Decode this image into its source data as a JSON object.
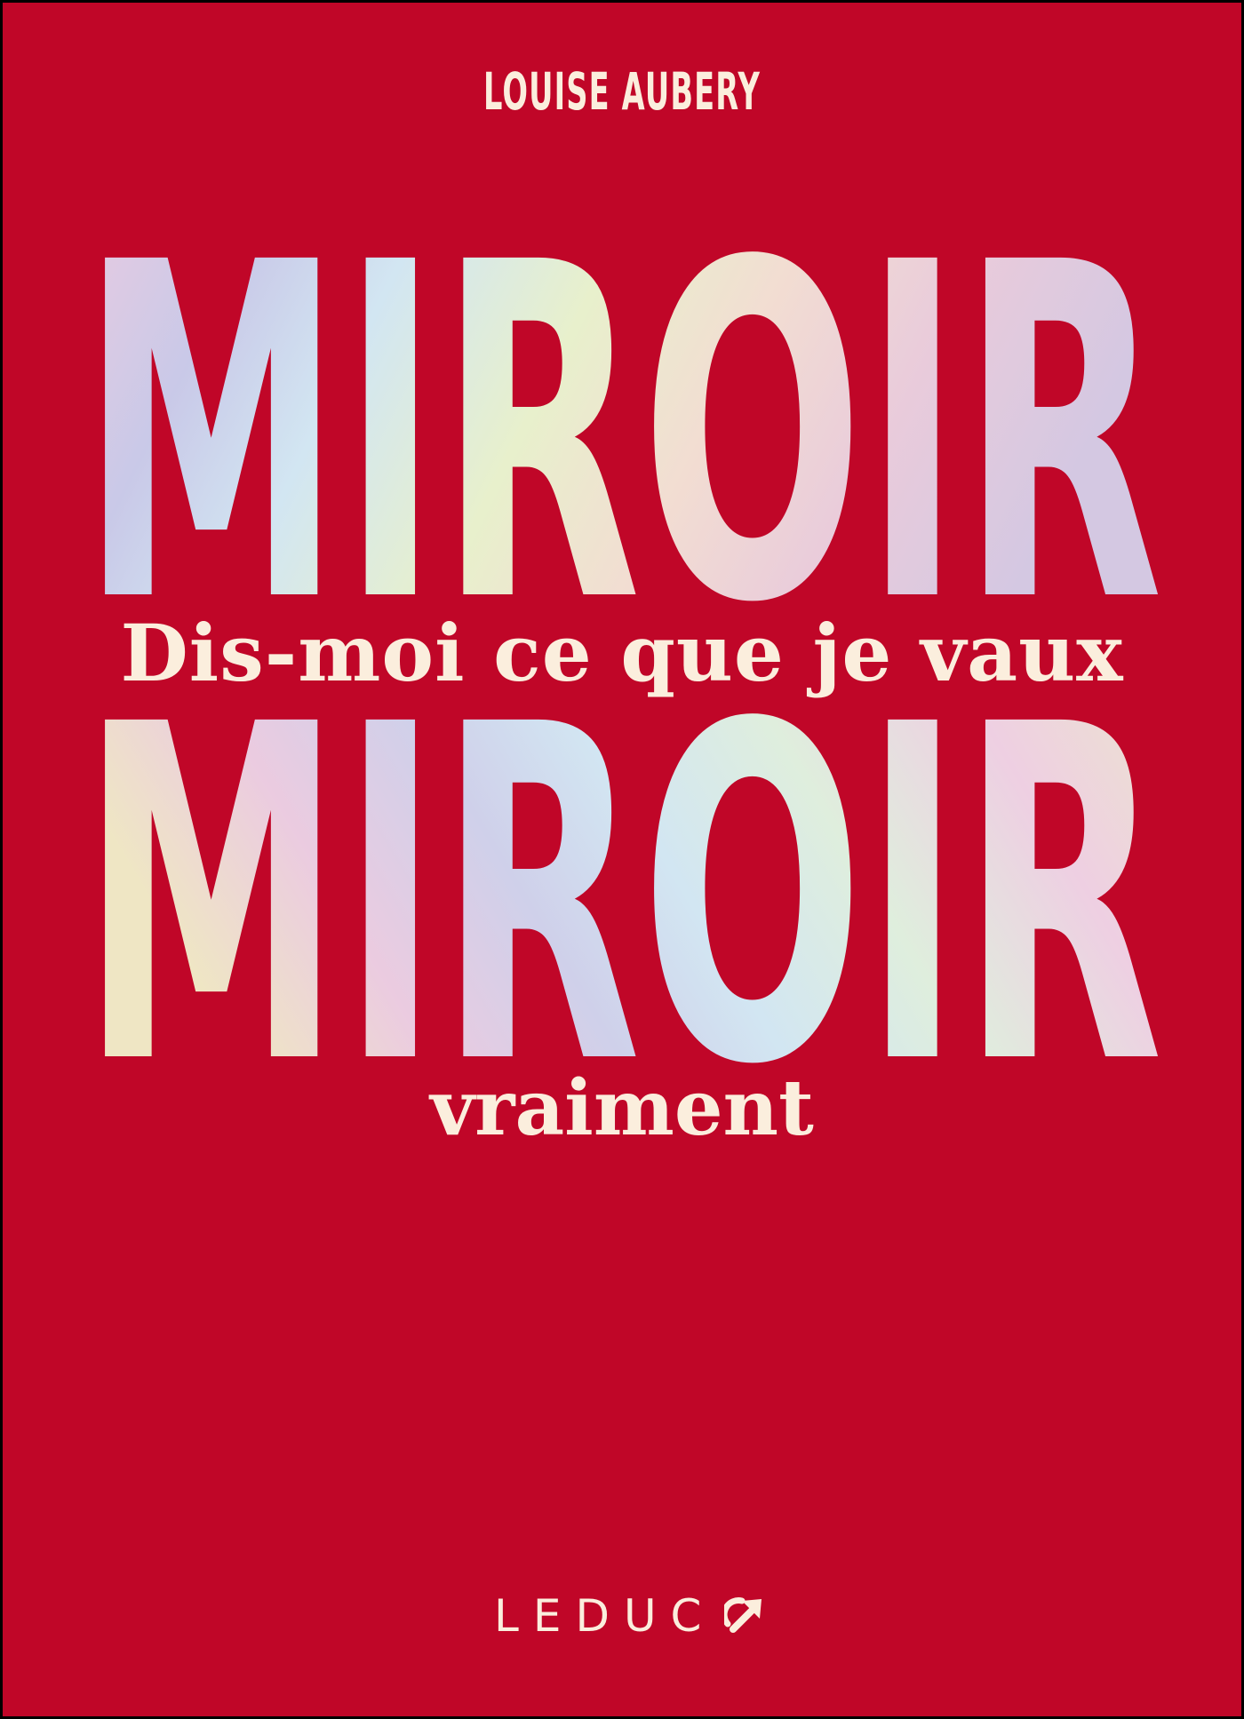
{
  "author": "LOUISE AUBERY",
  "title_line1": "MIROIR",
  "subtitle": "Dis-moi ce que je vaux",
  "title_line2": "MIROIR",
  "tagline": "vraiment",
  "publisher": {
    "name": "LEDUC",
    "icon": "arrow-up-right-icon"
  },
  "colors": {
    "background": "#c00628",
    "text": "#fbeedd",
    "holographic": [
      "#ecc9de",
      "#c9cbe6",
      "#cfe6f0",
      "#e6f0cd",
      "#f1dcd1",
      "#d9c7e0"
    ]
  }
}
